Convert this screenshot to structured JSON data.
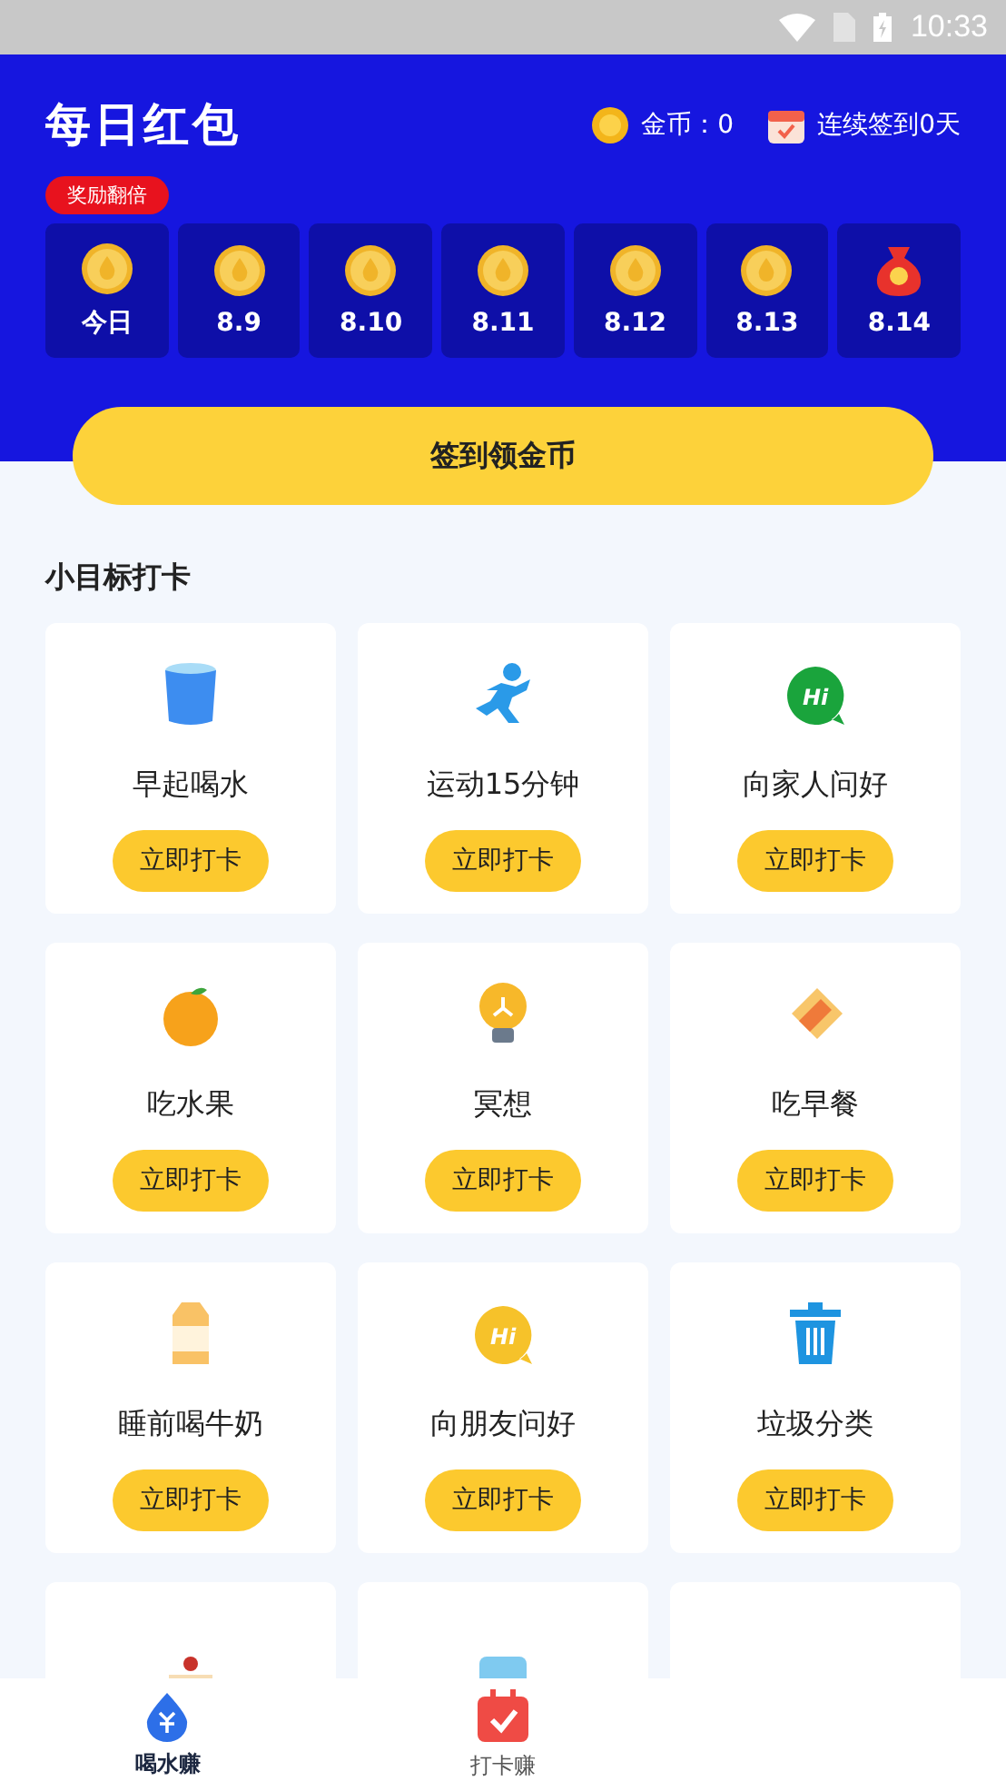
{
  "status_bar": {
    "time": "10:33"
  },
  "header": {
    "logo": "每日红包",
    "coins": "金币：0",
    "streak": "连续签到0天",
    "bonus_badge": "奖励翻倍",
    "days": [
      {
        "label": "今日",
        "kind": "coin"
      },
      {
        "label": "8.9",
        "kind": "coin"
      },
      {
        "label": "8.10",
        "kind": "coin"
      },
      {
        "label": "8.11",
        "kind": "coin"
      },
      {
        "label": "8.12",
        "kind": "coin"
      },
      {
        "label": "8.13",
        "kind": "coin"
      },
      {
        "label": "8.14",
        "kind": "bag"
      }
    ],
    "sign_button": "签到领金币"
  },
  "section_title": "小目标打卡",
  "tasks": [
    {
      "kind": "water",
      "label": "早起喝水",
      "button": "立即打卡"
    },
    {
      "kind": "run",
      "label": "运动15分钟",
      "button": "立即打卡"
    },
    {
      "kind": "hi",
      "icon_text": "Hi",
      "color": "#1aa43c",
      "label": "向家人问好",
      "button": "立即打卡"
    },
    {
      "kind": "fruit",
      "label": "吃水果",
      "button": "立即打卡"
    },
    {
      "kind": "bulb",
      "label": "冥想",
      "button": "立即打卡"
    },
    {
      "kind": "wrap",
      "label": "吃早餐",
      "button": "立即打卡"
    },
    {
      "kind": "milk",
      "label": "睡前喝牛奶",
      "button": "立即打卡"
    },
    {
      "kind": "hi",
      "icon_text": "Hi",
      "color": "#f6c22a",
      "label": "向朋友问好",
      "button": "立即打卡"
    },
    {
      "kind": "trash",
      "label": "垃圾分类",
      "button": "立即打卡"
    },
    {
      "kind": "cake"
    },
    {
      "kind": "box"
    },
    {
      "kind": "empty"
    }
  ],
  "bottom_nav": [
    {
      "kind": "drop",
      "label": "喝水赚",
      "selected": true
    },
    {
      "kind": "calendar",
      "label": "打卡赚",
      "selected": false
    }
  ]
}
